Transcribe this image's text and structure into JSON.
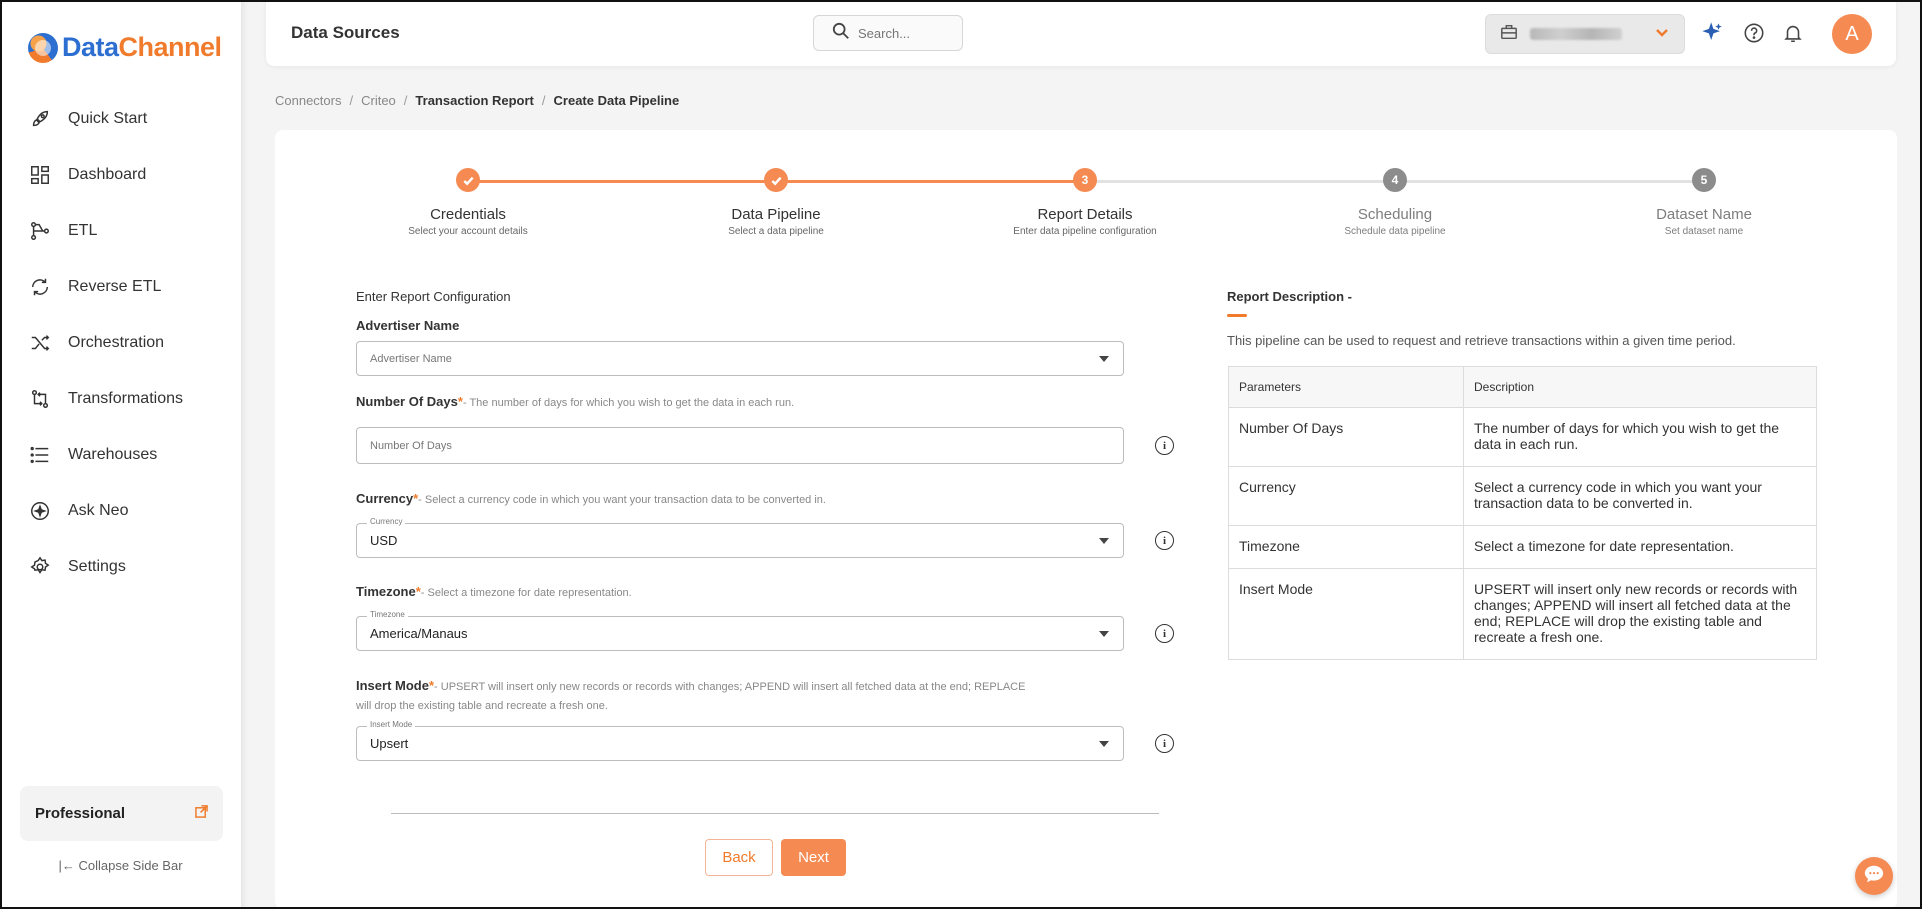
{
  "brand": {
    "part1": "Data",
    "part2": "Channel"
  },
  "colors": {
    "accent": "#f07b2c",
    "accent_soft": "#f58a52",
    "inactive_step": "#8c8c8c"
  },
  "sidebar": {
    "items": [
      {
        "label": "Quick Start",
        "icon": "rocket-icon"
      },
      {
        "label": "Dashboard",
        "icon": "dashboard-icon"
      },
      {
        "label": "ETL",
        "icon": "etl-icon"
      },
      {
        "label": "Reverse ETL",
        "icon": "reverse-etl-icon"
      },
      {
        "label": "Orchestration",
        "icon": "orchestration-icon"
      },
      {
        "label": "Transformations",
        "icon": "transformations-icon"
      },
      {
        "label": "Warehouses",
        "icon": "warehouses-icon"
      },
      {
        "label": "Ask Neo",
        "icon": "ask-neo-icon"
      },
      {
        "label": "Settings",
        "icon": "settings-icon"
      }
    ],
    "plan": "Professional",
    "collapse": "Collapse Side Bar"
  },
  "header": {
    "title": "Data Sources",
    "search_placeholder": "Search...",
    "avatar_letter": "A"
  },
  "breadcrumb": [
    "Connectors",
    "Criteo",
    "Transaction Report",
    "Create Data Pipeline"
  ],
  "steps": [
    {
      "num": "1",
      "title": "Credentials",
      "subtitle": "Select your account details",
      "state": "done"
    },
    {
      "num": "2",
      "title": "Data Pipeline",
      "subtitle": "Select a data pipeline",
      "state": "done"
    },
    {
      "num": "3",
      "title": "Report Details",
      "subtitle": "Enter data pipeline configuration",
      "state": "active"
    },
    {
      "num": "4",
      "title": "Scheduling",
      "subtitle": "Schedule data pipeline",
      "state": "future"
    },
    {
      "num": "5",
      "title": "Dataset Name",
      "subtitle": "Set dataset name",
      "state": "future"
    }
  ],
  "form": {
    "section_title": "Enter Report Configuration",
    "advertiser": {
      "label": "Advertiser Name",
      "placeholder": "Advertiser Name"
    },
    "days": {
      "label": "Number Of Days",
      "req": "*",
      "hint": "- The number of days for which you wish to get the data in each run.",
      "placeholder": "Number Of Days"
    },
    "currency": {
      "label": "Currency",
      "req": "*",
      "hint": "- Select a currency code in which you want your transaction data to be converted in.",
      "float_label": "Currency",
      "value": "USD"
    },
    "timezone": {
      "label": "Timezone",
      "req": "*",
      "hint": "- Select a timezone for date representation.",
      "float_label": "Timezone",
      "value": "America/Manaus"
    },
    "insert_mode": {
      "label": "Insert Mode",
      "req": "*",
      "hint_line1": "- UPSERT will insert only new records or records with changes; APPEND will insert all fetched data at the end; REPLACE",
      "hint_line2": "will drop the existing table and recreate a fresh one.",
      "float_label": "Insert Mode",
      "value": "Upsert"
    },
    "back": "Back",
    "next": "Next"
  },
  "report": {
    "title": "Report Description -",
    "text": "This pipeline can be used to request and retrieve transactions within a given time period.",
    "headers": [
      "Parameters",
      "Description"
    ],
    "rows": [
      {
        "param": "Number Of Days",
        "desc": "The number of days for which you wish to get the data in each run."
      },
      {
        "param": "Currency",
        "desc": "Select a currency code in which you want your transaction data to be converted in."
      },
      {
        "param": "Timezone",
        "desc": "Select a timezone for date representation."
      },
      {
        "param": "Insert Mode",
        "desc": "UPSERT will insert only new records or records with changes; APPEND will insert all fetched data at the end; REPLACE will drop the existing table and recreate a fresh one."
      }
    ]
  }
}
